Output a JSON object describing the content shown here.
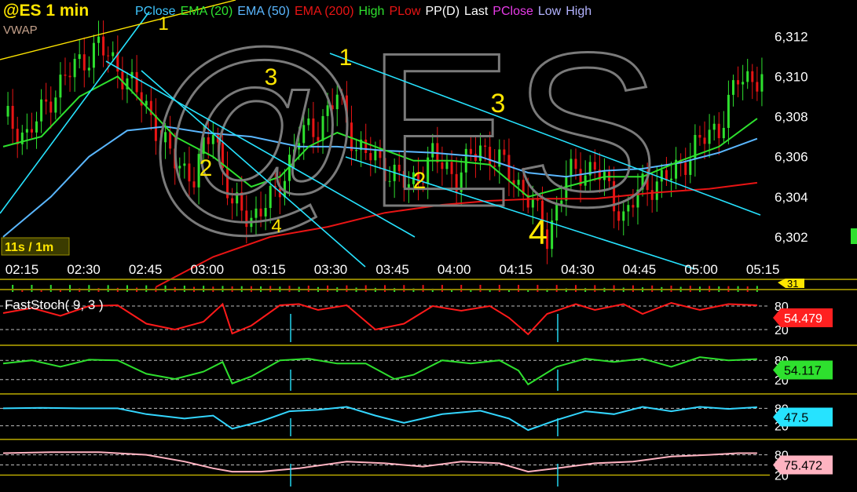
{
  "symbol_title": "@ES 1 min",
  "watermark": "@ES",
  "vwap_label": "VWAP",
  "legend": [
    {
      "label": "PClose",
      "color": "#3fc6ff"
    },
    {
      "label": "EMA (20)",
      "color": "#2ee02e"
    },
    {
      "label": "EMA (50)",
      "color": "#5ab7ff"
    },
    {
      "label": "EMA (200)",
      "color": "#e81414"
    },
    {
      "label": "High",
      "color": "#2ee02e"
    },
    {
      "label": "PLow",
      "color": "#e81414"
    },
    {
      "label": "PP(D)",
      "color": "#ffffff"
    },
    {
      "label": "Last",
      "color": "#ffffff"
    },
    {
      "label": "PClose",
      "color": "#e83be8"
    },
    {
      "label": "Low",
      "color": "#b3b3ff"
    },
    {
      "label": "High",
      "color": "#b3b3ff"
    }
  ],
  "interval_badge": "11s / 1m",
  "volume_badge": "31",
  "wave_labels": [
    "1",
    "2",
    "3",
    "4",
    "1",
    "2",
    "3",
    "4"
  ],
  "chart_data": {
    "type": "candlestick",
    "price_axis": {
      "ticks": [
        "6,312",
        "6,310",
        "6,308",
        "6,306",
        "6,304",
        "6,302"
      ],
      "ylim": [
        6300.9,
        6313.5
      ]
    },
    "time_ticks": [
      "02:15",
      "02:30",
      "02:45",
      "03:00",
      "03:15",
      "03:30",
      "03:45",
      "04:00",
      "04:15",
      "04:30",
      "04:45",
      "05:00",
      "05:15"
    ],
    "close_path": [
      [
        0,
        6308.0
      ],
      [
        5,
        6307.0
      ],
      [
        10,
        6309.0
      ],
      [
        15,
        6310.5
      ],
      [
        20,
        6311.5
      ],
      [
        24,
        6310.5
      ],
      [
        30,
        6308.5
      ],
      [
        35,
        6306.0
      ],
      [
        40,
        6305.0
      ],
      [
        44,
        6307.5
      ],
      [
        48,
        6303.5
      ],
      [
        52,
        6303.0
      ],
      [
        57,
        6304.0
      ],
      [
        62,
        6307.0
      ],
      [
        66,
        6307.5
      ],
      [
        70,
        6309.0
      ],
      [
        74,
        6306.5
      ],
      [
        80,
        6305.5
      ],
      [
        85,
        6304.5
      ],
      [
        90,
        6306.0
      ],
      [
        95,
        6305.0
      ],
      [
        100,
        6306.5
      ],
      [
        105,
        6305.5
      ],
      [
        110,
        6304.0
      ],
      [
        114,
        6302.0
      ],
      [
        118,
        6305.0
      ],
      [
        124,
        6305.5
      ],
      [
        130,
        6303.0
      ],
      [
        134,
        6304.5
      ],
      [
        140,
        6305.0
      ],
      [
        145,
        6306.5
      ],
      [
        150,
        6307.5
      ],
      [
        154,
        6309.8
      ],
      [
        158,
        6310.0
      ]
    ],
    "ema20_path": [
      [
        0,
        6306.5
      ],
      [
        8,
        6307.0
      ],
      [
        16,
        6309.0
      ],
      [
        24,
        6310.0
      ],
      [
        30,
        6308.5
      ],
      [
        36,
        6307.0
      ],
      [
        44,
        6306.0
      ],
      [
        52,
        6304.5
      ],
      [
        58,
        6305.0
      ],
      [
        64,
        6306.5
      ],
      [
        70,
        6307.2
      ],
      [
        78,
        6306.5
      ],
      [
        86,
        6305.8
      ],
      [
        94,
        6305.8
      ],
      [
        102,
        6305.6
      ],
      [
        110,
        6304.0
      ],
      [
        118,
        6304.5
      ],
      [
        126,
        6305.0
      ],
      [
        134,
        6305.0
      ],
      [
        142,
        6305.8
      ],
      [
        150,
        6306.5
      ],
      [
        158,
        6307.9
      ]
    ],
    "ema50_path": [
      [
        0,
        6302.0
      ],
      [
        10,
        6304.0
      ],
      [
        18,
        6306.0
      ],
      [
        26,
        6307.3
      ],
      [
        34,
        6307.5
      ],
      [
        42,
        6307.2
      ],
      [
        52,
        6307.0
      ],
      [
        62,
        6306.5
      ],
      [
        70,
        6306.5
      ],
      [
        80,
        6306.3
      ],
      [
        90,
        6306.2
      ],
      [
        100,
        6306.0
      ],
      [
        110,
        6305.2
      ],
      [
        118,
        6305.0
      ],
      [
        126,
        6305.3
      ],
      [
        134,
        6305.4
      ],
      [
        142,
        6305.7
      ],
      [
        150,
        6306.2
      ],
      [
        158,
        6306.9
      ]
    ],
    "ema200_path": [
      [
        32,
        6299.5
      ],
      [
        44,
        6301.0
      ],
      [
        56,
        6302.0
      ],
      [
        68,
        6302.5
      ],
      [
        80,
        6303.2
      ],
      [
        92,
        6303.6
      ],
      [
        102,
        6303.8
      ],
      [
        112,
        6303.9
      ],
      [
        124,
        6303.9
      ],
      [
        136,
        6304.2
      ],
      [
        148,
        6304.4
      ],
      [
        158,
        6304.7
      ]
    ],
    "stochastics": [
      {
        "name": "FastStoch( 9, 3 )",
        "value": "54.479",
        "color": "#ff1a1a",
        "tag_color": "#ff2020",
        "levels": [
          "80",
          "20"
        ],
        "path": [
          [
            0,
            62
          ],
          [
            6,
            75
          ],
          [
            12,
            55
          ],
          [
            18,
            80
          ],
          [
            24,
            82
          ],
          [
            30,
            35
          ],
          [
            36,
            20
          ],
          [
            42,
            40
          ],
          [
            46,
            85
          ],
          [
            48,
            10
          ],
          [
            52,
            30
          ],
          [
            58,
            82
          ],
          [
            62,
            85
          ],
          [
            66,
            70
          ],
          [
            72,
            82
          ],
          [
            78,
            20
          ],
          [
            84,
            35
          ],
          [
            90,
            80
          ],
          [
            96,
            68
          ],
          [
            102,
            80
          ],
          [
            106,
            50
          ],
          [
            110,
            8
          ],
          [
            114,
            60
          ],
          [
            120,
            85
          ],
          [
            124,
            70
          ],
          [
            130,
            85
          ],
          [
            134,
            60
          ],
          [
            140,
            88
          ],
          [
            146,
            70
          ],
          [
            152,
            85
          ],
          [
            158,
            82
          ]
        ]
      },
      {
        "name": "",
        "value": "54.117",
        "color": "#2ee02e",
        "tag_color": "#2ee02e",
        "levels": [
          "80",
          "20"
        ],
        "path": [
          [
            0,
            70
          ],
          [
            6,
            80
          ],
          [
            12,
            60
          ],
          [
            18,
            82
          ],
          [
            24,
            80
          ],
          [
            30,
            38
          ],
          [
            36,
            22
          ],
          [
            42,
            45
          ],
          [
            46,
            75
          ],
          [
            48,
            8
          ],
          [
            52,
            30
          ],
          [
            58,
            80
          ],
          [
            64,
            85
          ],
          [
            70,
            70
          ],
          [
            76,
            70
          ],
          [
            82,
            22
          ],
          [
            86,
            35
          ],
          [
            92,
            80
          ],
          [
            98,
            70
          ],
          [
            104,
            80
          ],
          [
            108,
            48
          ],
          [
            110,
            5
          ],
          [
            116,
            60
          ],
          [
            122,
            85
          ],
          [
            128,
            75
          ],
          [
            134,
            85
          ],
          [
            140,
            60
          ],
          [
            146,
            90
          ],
          [
            152,
            80
          ],
          [
            158,
            84
          ]
        ]
      },
      {
        "name": "",
        "value": "47.5",
        "color": "#33d6ff",
        "tag_color": "#26e3ff",
        "levels": [
          "80",
          "20"
        ],
        "path": [
          [
            0,
            80
          ],
          [
            8,
            82
          ],
          [
            16,
            80
          ],
          [
            24,
            80
          ],
          [
            30,
            60
          ],
          [
            38,
            45
          ],
          [
            44,
            55
          ],
          [
            48,
            10
          ],
          [
            54,
            35
          ],
          [
            60,
            70
          ],
          [
            66,
            75
          ],
          [
            72,
            85
          ],
          [
            78,
            55
          ],
          [
            84,
            30
          ],
          [
            92,
            60
          ],
          [
            100,
            72
          ],
          [
            106,
            45
          ],
          [
            110,
            5
          ],
          [
            116,
            40
          ],
          [
            122,
            70
          ],
          [
            128,
            60
          ],
          [
            134,
            85
          ],
          [
            140,
            70
          ],
          [
            146,
            85
          ],
          [
            152,
            78
          ],
          [
            158,
            84
          ]
        ]
      },
      {
        "name": "",
        "value": "75.472",
        "color": "#ffb3c1",
        "tag_color": "#ffb3c1",
        "levels": [
          "80",
          "50",
          "20"
        ],
        "path": [
          [
            0,
            85
          ],
          [
            10,
            88
          ],
          [
            20,
            88
          ],
          [
            30,
            80
          ],
          [
            38,
            60
          ],
          [
            44,
            40
          ],
          [
            48,
            30
          ],
          [
            54,
            30
          ],
          [
            62,
            40
          ],
          [
            72,
            60
          ],
          [
            80,
            55
          ],
          [
            88,
            45
          ],
          [
            96,
            60
          ],
          [
            104,
            55
          ],
          [
            110,
            30
          ],
          [
            116,
            40
          ],
          [
            124,
            55
          ],
          [
            132,
            60
          ],
          [
            140,
            75
          ],
          [
            148,
            80
          ],
          [
            154,
            85
          ],
          [
            158,
            85
          ]
        ]
      }
    ]
  }
}
